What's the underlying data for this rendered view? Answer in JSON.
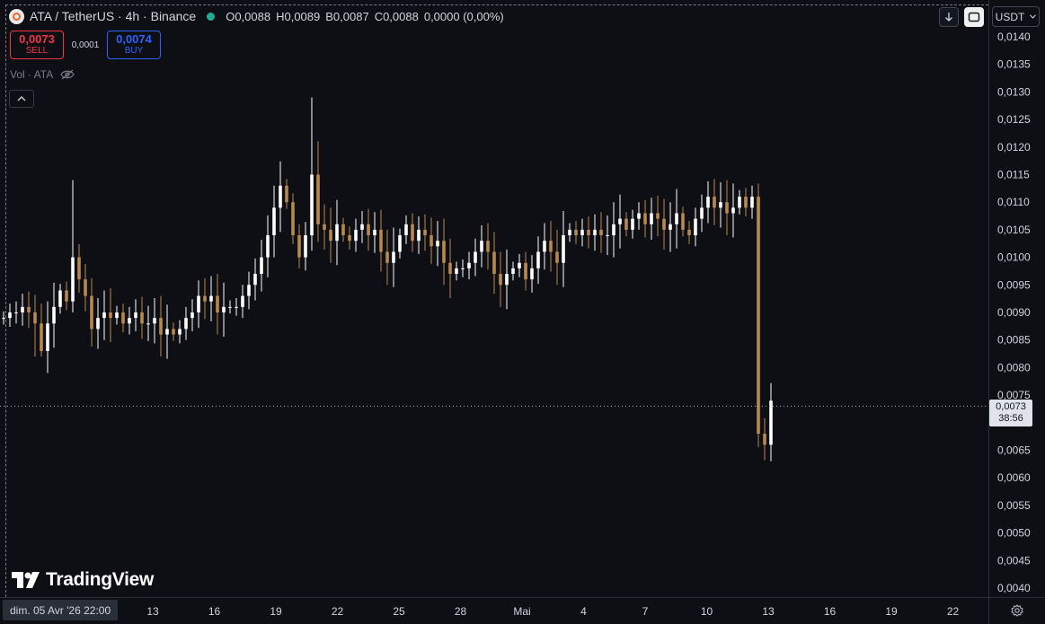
{
  "legend": {
    "title": "ATA / TetherUS · 4h · Binance",
    "ohlc": [
      {
        "label": "O",
        "value": "0,0088"
      },
      {
        "label": "H",
        "value": "0,0089"
      },
      {
        "label": "B",
        "value": "0,0087"
      },
      {
        "label": "C",
        "value": "0,0088"
      }
    ],
    "change": "0,0000 (0,00%)"
  },
  "trade": {
    "sell_price": "0,0073",
    "sell_label": "SELL",
    "spread": "0,0001",
    "buy_price": "0,0074",
    "buy_label": "BUY"
  },
  "volume_indicator": "Vol · ATA",
  "currency": "USDT",
  "current_price": {
    "value": "0,0073",
    "countdown": "38:56"
  },
  "time_axis": {
    "selected_date": "dim. 05 Avr '26   22:00",
    "labels": [
      "13",
      "16",
      "19",
      "22",
      "25",
      "28",
      "Mai",
      "4",
      "7",
      "10",
      "13",
      "16",
      "19",
      "22"
    ]
  },
  "logo_text": "TradingView",
  "colors": {
    "up": "#ffffff",
    "down": "#b8894f",
    "background": "#0e0f14",
    "sell": "#f23645",
    "buy": "#2962ff",
    "live": "#22ab94"
  },
  "chart_data": {
    "type": "candlestick",
    "yaxis": {
      "min": 0.004,
      "max": 0.014,
      "ticks": [
        0.014,
        0.0135,
        0.013,
        0.0125,
        0.012,
        0.0115,
        0.011,
        0.0105,
        0.01,
        0.0095,
        0.009,
        0.0085,
        0.008,
        0.0075,
        0.0065,
        0.006,
        0.0055,
        0.005,
        0.0045,
        0.004
      ],
      "tick_labels": [
        "0,0140",
        "0,0135",
        "0,0130",
        "0,0125",
        "0,0120",
        "0,0115",
        "0,0110",
        "0,0105",
        "0,0100",
        "0,0095",
        "0,0090",
        "0,0085",
        "0,0080",
        "0,0075",
        "0,0065",
        "0,0060",
        "0,0055",
        "0,0050",
        "0,0045",
        "0,0040"
      ]
    },
    "last_price": 0.0073,
    "close": [
      0.0089,
      0.009,
      0.009,
      0.0091,
      0.009,
      0.0088,
      0.0083,
      0.0088,
      0.0091,
      0.0094,
      0.0092,
      0.01,
      0.0096,
      0.0093,
      0.0087,
      0.0089,
      0.009,
      0.0089,
      0.009,
      0.0088,
      0.0089,
      0.009,
      0.0088,
      0.0088,
      0.0089,
      0.0086,
      0.0087,
      0.0086,
      0.0087,
      0.0089,
      0.009,
      0.0093,
      0.0092,
      0.0093,
      0.009,
      0.0091,
      0.0091,
      0.0091,
      0.0093,
      0.0095,
      0.0097,
      0.01,
      0.0104,
      0.0109,
      0.0113,
      0.011,
      0.0104,
      0.01,
      0.0104,
      0.0115,
      0.0106,
      0.0105,
      0.0103,
      0.0106,
      0.0104,
      0.0103,
      0.0105,
      0.0106,
      0.0104,
      0.0105,
      0.0101,
      0.0099,
      0.0101,
      0.0104,
      0.0106,
      0.0103,
      0.0105,
      0.0104,
      0.0102,
      0.0103,
      0.0099,
      0.0097,
      0.0098,
      0.0098,
      0.0099,
      0.0101,
      0.0103,
      0.0101,
      0.0097,
      0.0095,
      0.0097,
      0.0098,
      0.0099,
      0.0096,
      0.0098,
      0.0101,
      0.0103,
      0.0101,
      0.0099,
      0.0104,
      0.0105,
      0.0104,
      0.0105,
      0.0104,
      0.0105,
      0.0104,
      0.0104,
      0.0106,
      0.0107,
      0.0105,
      0.0107,
      0.0108,
      0.0106,
      0.0108,
      0.0107,
      0.0105,
      0.0106,
      0.0108,
      0.0105,
      0.0104,
      0.0107,
      0.0109,
      0.0111,
      0.0109,
      0.011,
      0.0108,
      0.0109,
      0.0111,
      0.0109,
      0.0111,
      0.0068,
      0.0066,
      0.0074
    ]
  }
}
